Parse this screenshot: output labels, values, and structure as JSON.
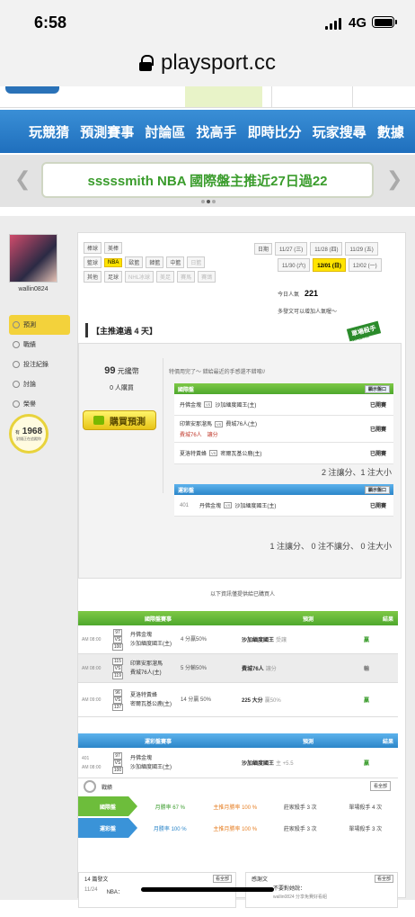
{
  "status": {
    "time": "6:58",
    "network": "4G"
  },
  "browser": {
    "url": "playsport.cc"
  },
  "nav": {
    "items": [
      "玩競猜",
      "預測賽事",
      "討論區",
      "找高手",
      "即時比分",
      "玩家搜尋",
      "數據"
    ]
  },
  "banner": {
    "text": "sssssmith NBA 國際盤主推近27日過22"
  },
  "profile": {
    "username": "wallin0824",
    "menu": [
      "預測",
      "戰績",
      "投注紀錄",
      "討論",
      "榮譽"
    ],
    "count": "1968",
    "count_prefix": "有",
    "count_note": "對錢正在追蹤你"
  },
  "filters": {
    "row1": [
      "棒球",
      "美棒"
    ],
    "row2": [
      "籃球",
      "NBA",
      "歐籃",
      "韓籃",
      "中籃",
      "日籃"
    ],
    "row3": [
      "其他",
      "足球",
      "NHL冰球",
      "美足",
      "賽馬",
      "賽鴿"
    ],
    "date_label": "日期",
    "dates": [
      "11/27 (三)",
      "11/28 (四)",
      "11/29 (五)",
      "11/30 (六)",
      "12/01 (日)",
      "12/02 (一)"
    ],
    "today_label": "今日人氣",
    "today_value": "221",
    "info_note": "多發文可以增加人氣喔～"
  },
  "streak": "【主推連過 4 天】",
  "emblem": {
    "title": "單場殺手",
    "sub": "NBA國際盤"
  },
  "buy": {
    "price": "99",
    "price_unit": "元纔幣",
    "buyers": "0 人購買",
    "button": "購買預測",
    "tagline": "特價用完了～ 錯給最近的手感還不錯唷//"
  },
  "intl": {
    "header": "國際盤",
    "btn": "顯示盤口",
    "rows": [
      {
        "home": "丹佛金塊",
        "away": "沙加緬度國王(主)",
        "status": "已開賽",
        "extra": ""
      },
      {
        "home": "印第安那溜馬",
        "away": "費城76人(主)",
        "status": "已開賽",
        "extra": "費城76人　讓分"
      },
      {
        "home": "夏洛特黃蜂",
        "away": "密爾瓦基公鹿(主)",
        "status": "已開賽",
        "extra": ""
      }
    ],
    "summary": "2 注讓分、1 注大小"
  },
  "lottery": {
    "header": "運彩盤",
    "btn": "顯示盤口",
    "rows": [
      {
        "id": "401",
        "home": "丹佛金塊",
        "away": "沙加緬度國王(主)",
        "status": "已開賽"
      }
    ],
    "summary": "1 注讓分、 0 注不讓分、 0 注大小"
  },
  "note": "以下資訊僅提供給已購買人",
  "t1": {
    "headers": [
      "國際盤賽事",
      "預測",
      "結果"
    ],
    "rows": [
      {
        "time": "AM 08:00",
        "n1": "97",
        "n2": "100",
        "home": "丹佛金塊",
        "away": "沙加緬度國王(主)",
        "line": "4 分贏50%",
        "pick": "沙加緬度國王",
        "pick_note": "受讓",
        "result": "贏"
      },
      {
        "time": "AM 08:00",
        "n1": "115",
        "n2": "119",
        "home": "印第安那溜馬",
        "away": "費城76人(主)",
        "line": "5 分輸50%",
        "pick": "費城76人",
        "pick_note": "讓分",
        "result": "輸"
      },
      {
        "time": "AM 09:00",
        "n1": "96",
        "n2": "137",
        "home": "夏洛特黃蜂",
        "away": "密爾瓦基公鹿(主)",
        "line": "14 分贏 50%",
        "pick": "225 大分",
        "pick_note": "贏50%",
        "result": "贏"
      }
    ]
  },
  "t2": {
    "headers": [
      "運彩盤賽事",
      "預測",
      "結果"
    ],
    "rows": [
      {
        "id": "401",
        "time": "AM 08:00",
        "n1": "97",
        "n2": "100",
        "home": "丹佛金塊",
        "away": "沙加緬度國王(主)",
        "pick": "沙加緬度國王",
        "pick_note": "主 +5.5",
        "result": "贏"
      }
    ]
  },
  "stats": {
    "title": "戰績",
    "btn": "看全部",
    "rows": [
      {
        "label": "國際盤",
        "c1": "月勝率 67 %",
        "c2": "主推月勝率 100 %",
        "c3": "莊家殺手 3 次",
        "c4": "單場殺手 4 次"
      },
      {
        "label": "運彩盤",
        "c1": "月勝率 100 %",
        "c2": "主推月勝率 100 %",
        "c3": "莊家殺手 3 次",
        "c4": "單場殺手 3 次"
      }
    ]
  },
  "bottom": {
    "left_title": "14 篇發文",
    "left_btn": "看全部",
    "right_title": "感謝文",
    "right_btn": "看全部",
    "post_label": "NBA：",
    "post_date": "11/24",
    "right_text": "不要對她說：",
    "right_sub": "wallin0824 分享免費好看組"
  }
}
